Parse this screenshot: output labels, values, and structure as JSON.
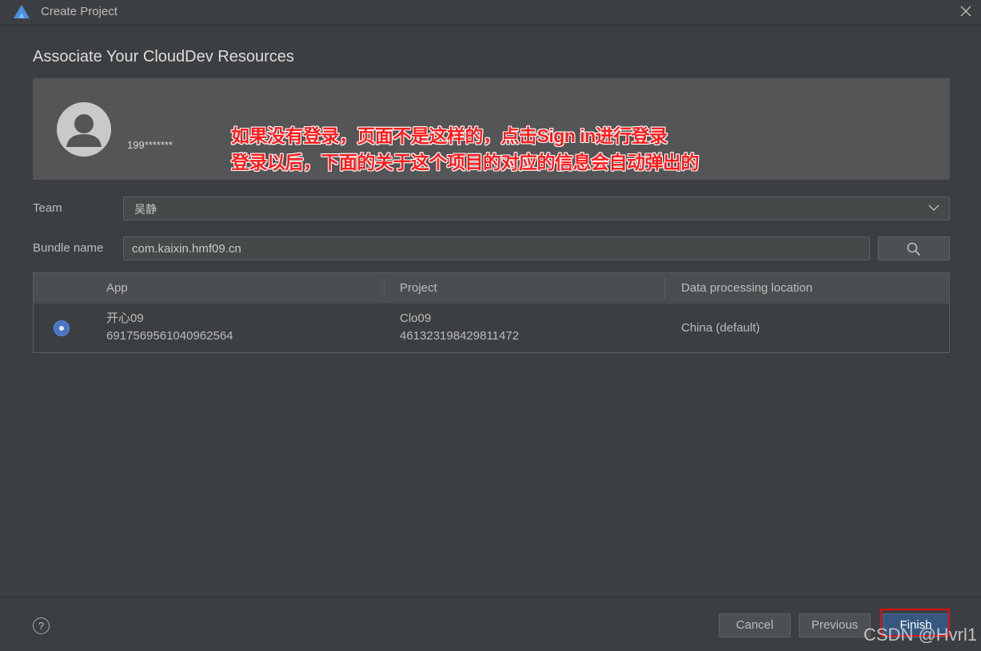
{
  "window": {
    "title": "Create Project",
    "logo_icon": "deveco-logo-icon",
    "close_icon": "close-icon"
  },
  "page": {
    "heading": "Associate Your CloudDev Resources"
  },
  "account": {
    "id": "199*******",
    "note_line1": "如果没有登录，页面不是这样的，点击Sign in进行登录",
    "note_line2": "登录以后，下面的关于这个项目的对应的信息会自动弹出的"
  },
  "form": {
    "team_label": "Team",
    "team_value": "吴静",
    "bundle_label": "Bundle name",
    "bundle_value": "com.kaixin.hmf09.cn"
  },
  "table": {
    "headers": [
      "App",
      "Project",
      "Data processing location"
    ],
    "rows": [
      {
        "selected": true,
        "app_name": "开心09",
        "app_id": "6917569561040962564",
        "project_name": "Clo09",
        "project_id": "461323198429811472",
        "location": "China (default)"
      }
    ]
  },
  "footer": {
    "help": "?",
    "cancel": "Cancel",
    "previous": "Previous",
    "finish": "Finish"
  },
  "watermark": "CSDN @Hvrl1",
  "colors": {
    "background": "#3c3f41",
    "accent": "#365880",
    "radio": "#4a75c4",
    "annotation": "#ff1a1a"
  }
}
